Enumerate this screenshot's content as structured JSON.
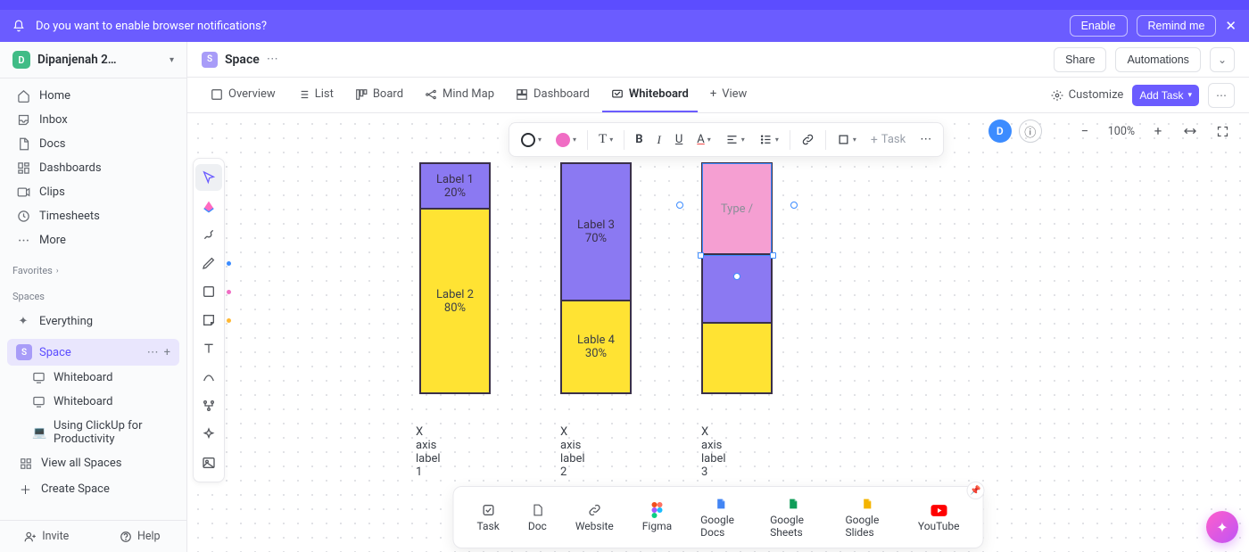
{
  "notification": {
    "text": "Do you want to enable browser notifications?",
    "enable": "Enable",
    "remind": "Remind me"
  },
  "workspace": {
    "initial": "D",
    "name": "Dipanjenah 2…"
  },
  "sidebar": {
    "home": "Home",
    "inbox": "Inbox",
    "docs": "Docs",
    "dashboards": "Dashboards",
    "clips": "Clips",
    "timesheets": "Timesheets",
    "more": "More",
    "favorites": "Favorites",
    "spaces": "Spaces",
    "everything": "Everything",
    "space": {
      "initial": "S",
      "name": "Space"
    },
    "whiteboard1": "Whiteboard",
    "whiteboard2": "Whiteboard",
    "productivity": "Using ClickUp for Productivity",
    "viewall": "View all Spaces",
    "create": "Create Space",
    "invite": "Invite",
    "help": "Help"
  },
  "breadcrumb": {
    "initial": "S",
    "name": "Space",
    "share": "Share",
    "automations": "Automations"
  },
  "tabs": {
    "overview": "Overview",
    "list": "List",
    "board": "Board",
    "mindmap": "Mind Map",
    "dashboard": "Dashboard",
    "whiteboard": "Whiteboard",
    "view": "View",
    "customize": "Customize",
    "addtask": "Add Task"
  },
  "toolbar": {
    "task": "Task"
  },
  "zoom": {
    "value": "100%",
    "avatar": "D"
  },
  "chart_data": {
    "type": "bar",
    "stacked": true,
    "categories": [
      "X axis label 1",
      "X axis label 2",
      "X axis label 3"
    ],
    "series": [
      {
        "stack": 0,
        "segments": [
          {
            "label": "Label 1",
            "value": 20,
            "color": "#8b79f2"
          },
          {
            "label": "Label 2",
            "value": 80,
            "color": "#ffe333"
          }
        ]
      },
      {
        "stack": 1,
        "segments": [
          {
            "label": "Label 3",
            "value": 70,
            "color": "#8b79f2"
          },
          {
            "label": "Lable 4",
            "value": 30,
            "color": "#ffe333"
          }
        ]
      },
      {
        "stack": 2,
        "segments": [
          {
            "label": "Type /",
            "value": 40,
            "color": "#f59fd2"
          },
          {
            "label": "",
            "value": 30,
            "color": "#8b79f2"
          },
          {
            "label": "",
            "value": 30,
            "color": "#ffe333"
          }
        ]
      }
    ]
  },
  "dock": {
    "task": "Task",
    "doc": "Doc",
    "website": "Website",
    "figma": "Figma",
    "gdocs": "Google Docs",
    "gsheets": "Google Sheets",
    "gslides": "Google Slides",
    "youtube": "YouTube"
  }
}
